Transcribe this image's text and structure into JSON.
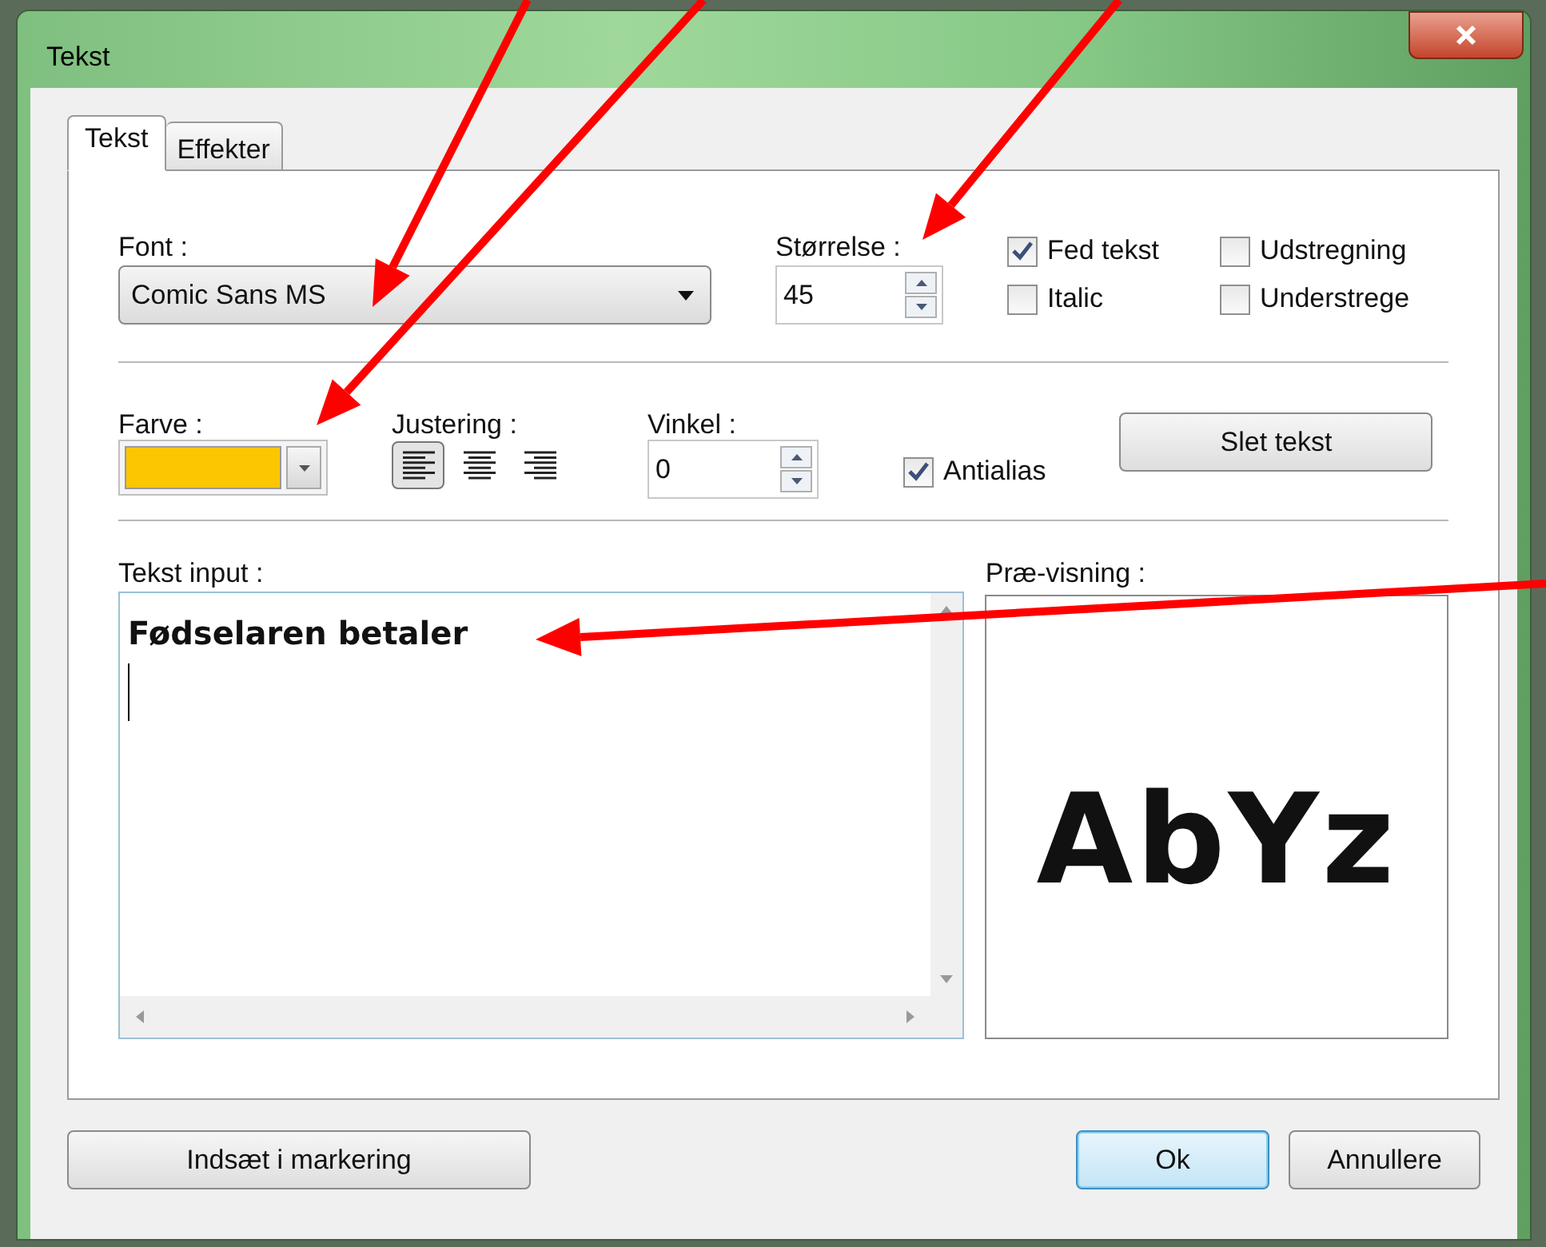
{
  "window": {
    "title": "Tekst"
  },
  "tabs": [
    {
      "label": "Tekst",
      "selected": true
    },
    {
      "label": "Effekter",
      "selected": false
    }
  ],
  "font": {
    "label": "Font :",
    "value": "Comic Sans MS"
  },
  "size": {
    "label": "Størrelse :",
    "value": "45"
  },
  "styles": [
    {
      "label": "Fed tekst",
      "checked": true
    },
    {
      "label": "Udstregning",
      "checked": false
    },
    {
      "label": "Italic",
      "checked": false
    },
    {
      "label": "Understrege",
      "checked": false
    }
  ],
  "color": {
    "label": "Farve :",
    "color": "#fcc600"
  },
  "alignment": {
    "label": "Justering :",
    "options": [
      {
        "kind": "left",
        "selected": true
      },
      {
        "kind": "center",
        "selected": false
      },
      {
        "kind": "right",
        "selected": false
      }
    ]
  },
  "angle": {
    "label": "Vinkel :",
    "value": "0"
  },
  "antialias": {
    "label": "Antialias",
    "checked": true
  },
  "clear_button": "Slet tekst",
  "text_input": {
    "label": "Tekst input :",
    "value": "Fødselaren betaler"
  },
  "preview": {
    "label": "Præ-visning :",
    "sample": "AbYz"
  },
  "buttons": [
    {
      "label": "Indsæt i markering",
      "focused": false
    },
    {
      "label": "Ok",
      "focused": true
    },
    {
      "label": "Annullere",
      "focused": false
    }
  ]
}
